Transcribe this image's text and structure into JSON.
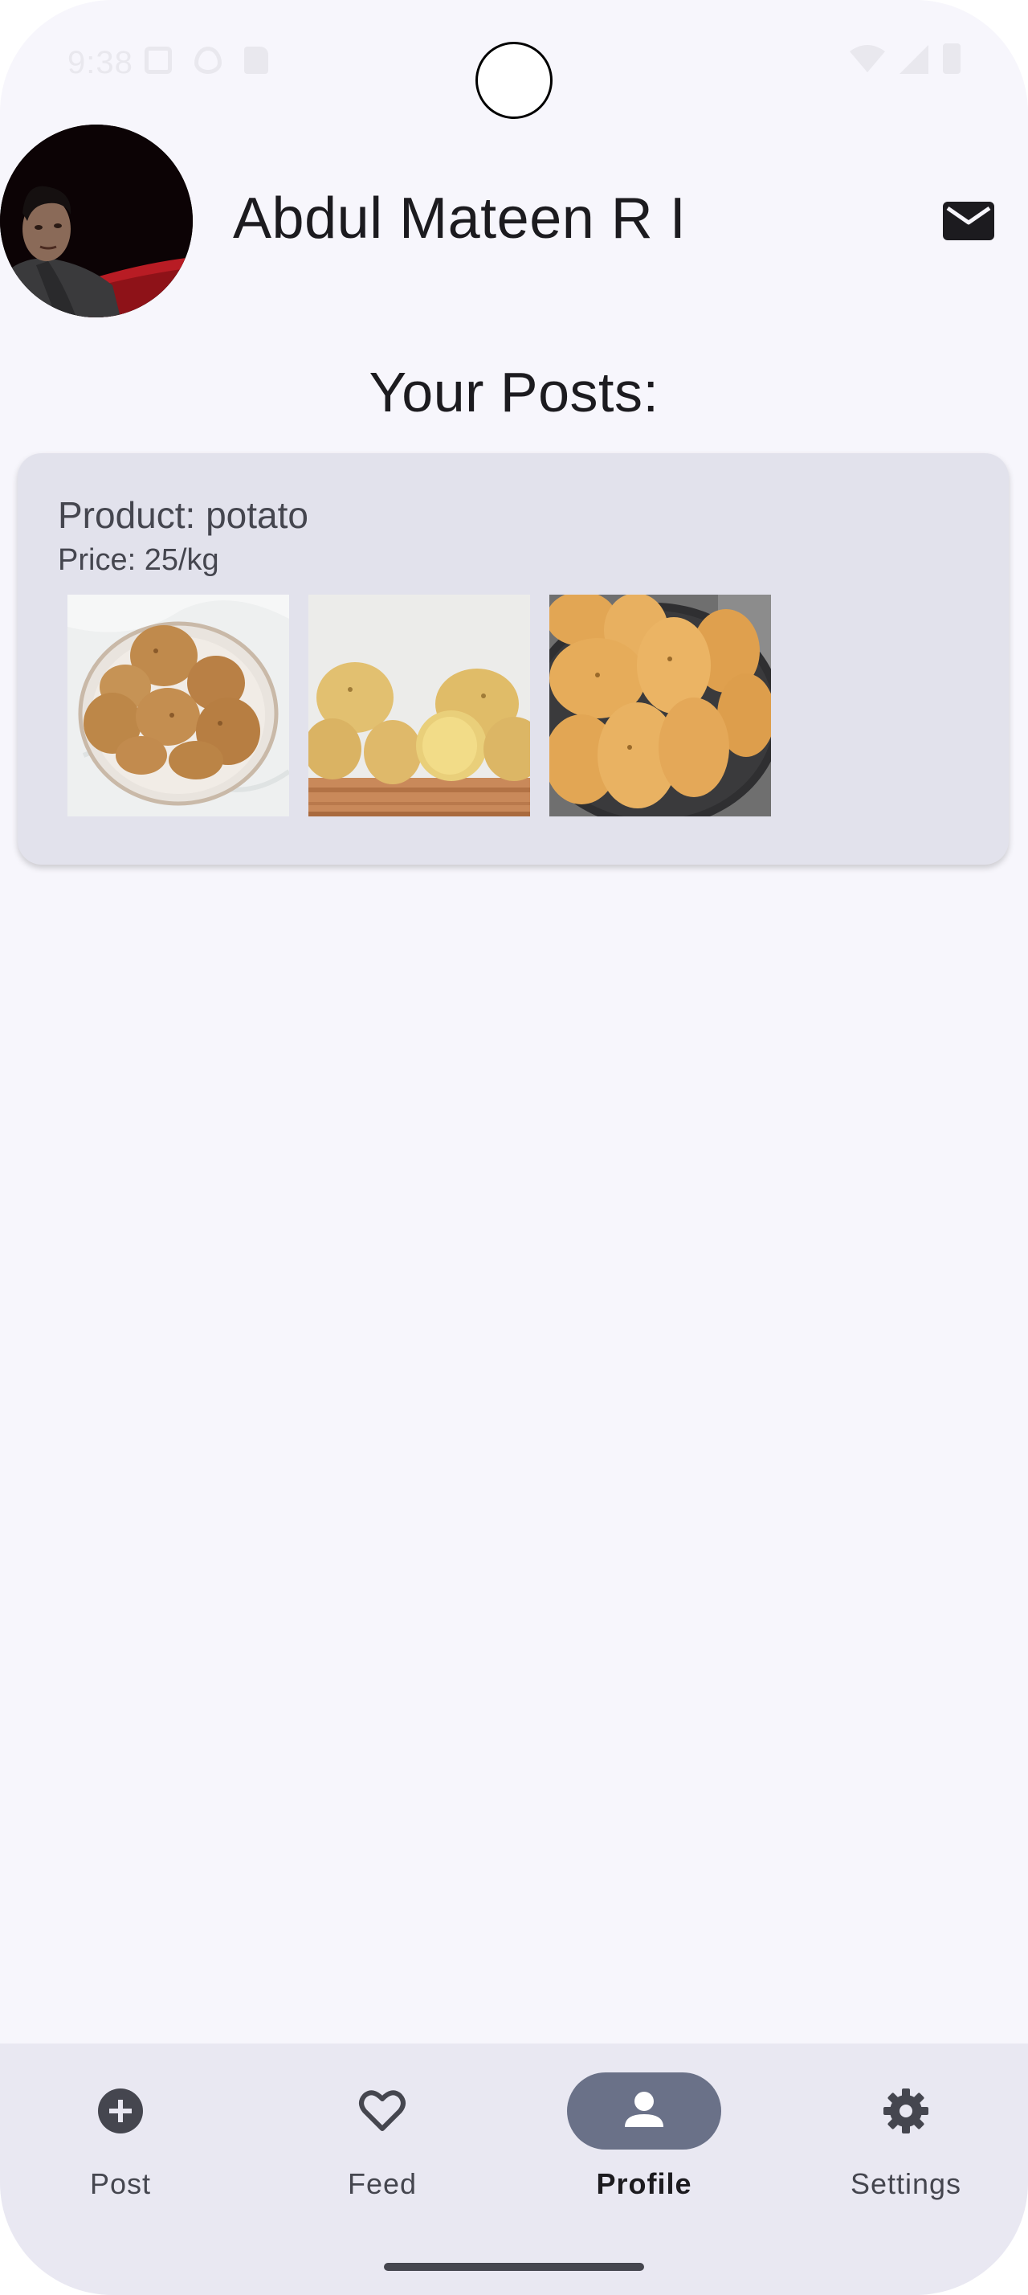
{
  "status_bar": {
    "time": "9:38",
    "icons_left": [
      "screenshot-icon",
      "shield-icon",
      "sd-card-icon"
    ],
    "icons_right": [
      "wifi-icon",
      "signal-icon",
      "battery-icon"
    ]
  },
  "profile": {
    "name": "Abdul Mateen R I",
    "avatar_icon": "user-photo",
    "message_icon": "mail-icon"
  },
  "section_title": "Your Posts:",
  "posts": [
    {
      "product": "Product: potato",
      "price": "Price: 25/kg",
      "images": [
        "potatoes-in-glass-bowl",
        "potatoes-on-wooden-board",
        "potatoes-in-dark-pan"
      ]
    }
  ],
  "bottom_nav": {
    "items": [
      {
        "label": "Post",
        "icon": "add-circle-icon",
        "active": false
      },
      {
        "label": "Feed",
        "icon": "heart-icon",
        "active": false
      },
      {
        "label": "Profile",
        "icon": "person-icon",
        "active": true
      },
      {
        "label": "Settings",
        "icon": "gear-icon",
        "active": false
      }
    ]
  },
  "colors": {
    "background": "#f7f6fc",
    "card": "#e2e2ec",
    "nav_background": "#e9e8f2",
    "nav_active_indicator": "#6a7188",
    "text_primary": "#1c1b1f",
    "text_secondary": "#45464f"
  }
}
